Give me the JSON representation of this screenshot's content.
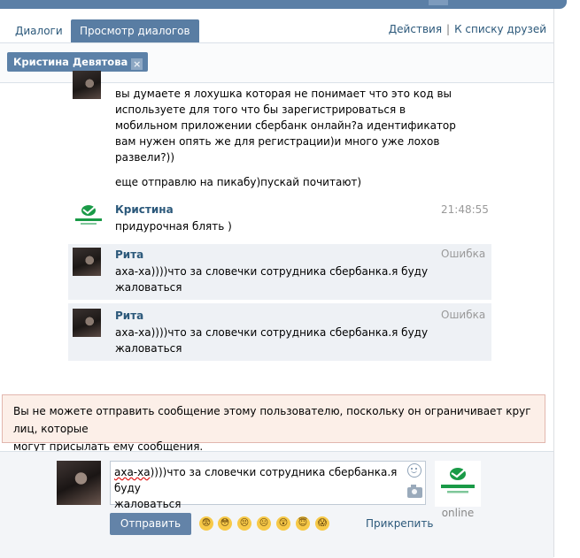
{
  "tabs": [
    {
      "label": "Диалоги"
    },
    {
      "label": "Просмотр диалогов"
    }
  ],
  "top_links": {
    "actions": "Действия",
    "separator": "|",
    "friends": "К списку друзей"
  },
  "recipient": {
    "name": "Кристина Девятова"
  },
  "messages": [
    {
      "lines": [
        "вы думаете я лохушка которая не понимает что это код вы",
        "используете для того что бы зарегистрироваться в",
        "мобильном приложении сбербанк онлайн?а идентификатор",
        "вам нужен опять же для регистрации)и много уже лохов",
        "развели?))"
      ]
    },
    {
      "lines": [
        "еще отправлю на пикабу)пускай почитают)"
      ]
    },
    {
      "author": "Кристина",
      "time": "21:48:55",
      "lines": [
        "придурочная блять )"
      ]
    },
    {
      "author": "Рита",
      "status": "Ошибка",
      "lines": [
        "аха-ха))))что за словечки сотрудника сбербанка.я буду",
        "жаловаться"
      ]
    },
    {
      "author": "Рита",
      "status": "Ошибка",
      "lines": [
        "аха-ха))))что за словечки сотрудника сбербанка.я буду",
        "жаловаться"
      ]
    }
  ],
  "warning": {
    "lines": [
      "Вы не можете отправить сообщение этому пользователю, поскольку он ограничивает круг лиц, которые",
      "могут присылать ему сообщения."
    ]
  },
  "composer": {
    "text_first_word": "аха-ха",
    "text_rest": "))))что за словечки сотрудника сбербанка.я буду",
    "text_line2": "жаловаться",
    "send_label": "Отправить",
    "attach_label": "Прикрепить",
    "online_label": "online",
    "emojis": [
      "😨",
      "😳",
      "😣",
      "😐",
      "😲",
      "😇",
      "😱"
    ]
  },
  "colors": {
    "accent": "#597da3",
    "link": "#2b587a",
    "warning_bg": "#fcefe8",
    "sber_green": "#1a9a47"
  }
}
